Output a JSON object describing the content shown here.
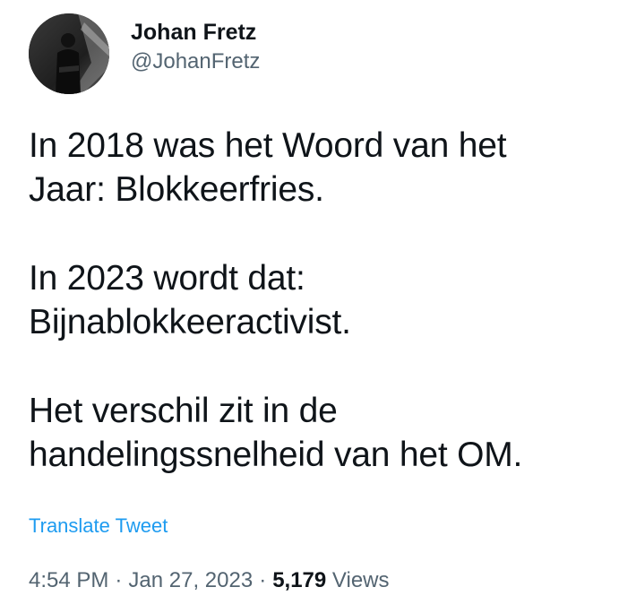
{
  "author": {
    "display_name": "Johan Fretz",
    "handle": "@JohanFretz",
    "avatar_icon": "profile-photo"
  },
  "tweet": {
    "paragraphs": [
      {
        "lines": [
          "In 2018 was het Woord van het",
          "Jaar: Blokkeerfries."
        ]
      },
      {
        "lines": [
          "In 2023 wordt dat:",
          "Bijnablokkeeractivist."
        ]
      },
      {
        "lines": [
          "Het verschil zit in de",
          "handelingssnelheid van het OM."
        ]
      }
    ],
    "translate_label": "Translate Tweet"
  },
  "meta": {
    "time": "4:54 PM",
    "separator": "·",
    "date": "Jan 27, 2023",
    "views_count": "5,179",
    "views_label": "Views"
  },
  "colors": {
    "text": "#0f1419",
    "secondary": "#536471",
    "link": "#1d9bf0"
  }
}
